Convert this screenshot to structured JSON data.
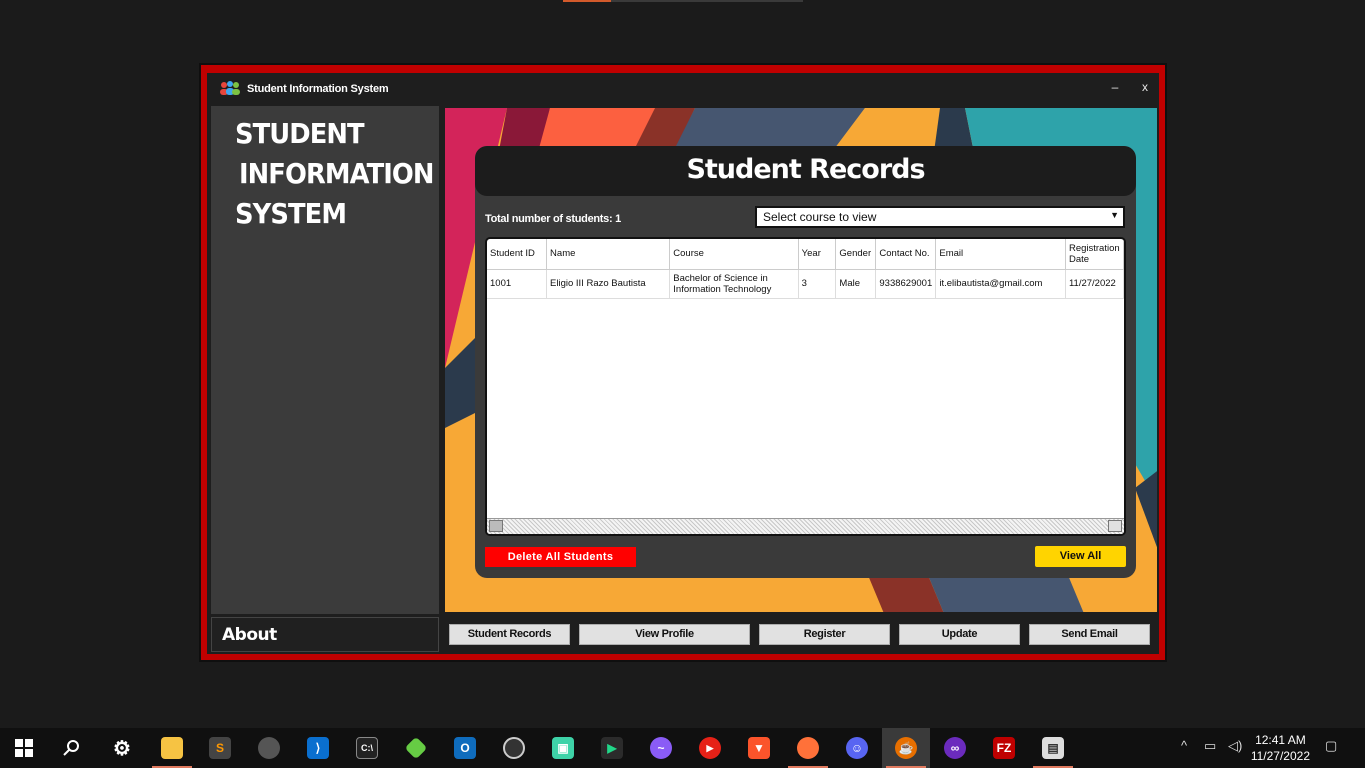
{
  "window": {
    "title": "Student Information System",
    "minimize": "–",
    "close": "x"
  },
  "sidebar": {
    "brand_line1": "STUDENT",
    "brand_line2": "INFORMATION",
    "brand_line3": "SYSTEM",
    "about": "About"
  },
  "records": {
    "heading": "Student Records",
    "total_label": "Total number of students: 1",
    "course_select_value": "Select course to view",
    "columns": [
      "Student ID",
      "Name",
      "Course",
      "Year",
      "Gender",
      "Contact No.",
      "Email",
      "Registration Date"
    ],
    "rows": [
      [
        "1001",
        "Eligio III Razo Bautista",
        "Bachelor of Science in Information Technology",
        "3",
        "Male",
        "9338629001",
        "it.elibautista@gmail.com",
        "11/27/2022"
      ]
    ],
    "delete_all": "Delete All Students",
    "view_all": "View All"
  },
  "nav": {
    "student_records": "Student Records",
    "view_profile": "View Profile",
    "register": "Register",
    "update": "Update",
    "send_email": "Send Email"
  },
  "colors": {
    "window_border": "#c00000",
    "delete_button": "#ff0000",
    "view_all_button": "#ffd400",
    "background_orange": "#f7a836",
    "background_teal": "#2ea3aa",
    "background_magenta": "#d3245a",
    "background_red_orange": "#fc6040",
    "background_slate": "#465670"
  },
  "taskbar": {
    "time": "12:41 AM",
    "date": "11/27/2022",
    "icons": [
      "windows-start-icon",
      "search-icon",
      "settings-icon",
      "file-explorer-icon",
      "sublime-text-icon",
      "app-icon",
      "vscode-icon",
      "terminal-icon",
      "git-icon",
      "outlook-icon",
      "obs-icon",
      "app-icon",
      "pycharm-icon",
      "messenger-icon",
      "youtube-icon",
      "brave-icon",
      "firefox-icon",
      "discord-icon",
      "java-app-icon",
      "app-icon",
      "filezilla-icon",
      "app-icon"
    ]
  }
}
